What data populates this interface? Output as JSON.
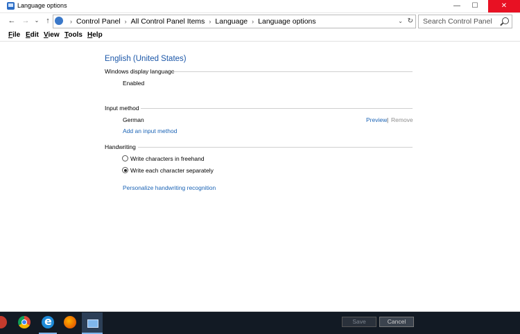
{
  "window": {
    "title": "Language options",
    "minimize": "—",
    "maximize": "☐",
    "close": "✕"
  },
  "nav": {
    "back": "←",
    "forward": "→",
    "recent": "⌄",
    "up": "↑"
  },
  "address": {
    "crumbs": [
      "Control Panel",
      "All Control Panel Items",
      "Language",
      "Language options"
    ],
    "dropdown": "⌄",
    "refresh": "↻"
  },
  "search": {
    "placeholder": "Search Control Panel"
  },
  "menu": {
    "file": {
      "u": "F",
      "rest": "ile"
    },
    "edit": {
      "u": "E",
      "rest": "dit"
    },
    "view": {
      "u": "V",
      "rest": "iew"
    },
    "tools": {
      "u": "T",
      "rest": "ools"
    },
    "help": {
      "u": "H",
      "rest": "elp"
    }
  },
  "language": {
    "title": "English (United States)",
    "display": {
      "heading": "Windows display language",
      "status": "Enabled"
    },
    "input": {
      "heading": "Input method",
      "method": "German",
      "preview": "Preview",
      "divider": "|",
      "remove": "Remove",
      "add": "Add an input method"
    },
    "handwriting": {
      "heading": "Handwriting",
      "option1": "Write characters in freehand",
      "option2": "Write each character separately",
      "selected": "option2",
      "personalize": "Personalize handwriting recognition"
    }
  },
  "buttons": {
    "save": "Save",
    "cancel": "Cancel"
  },
  "colors": {
    "link": "#1a63b5",
    "title": "#1a56a8",
    "close": "#e81123",
    "taskbar": "#121a24"
  }
}
